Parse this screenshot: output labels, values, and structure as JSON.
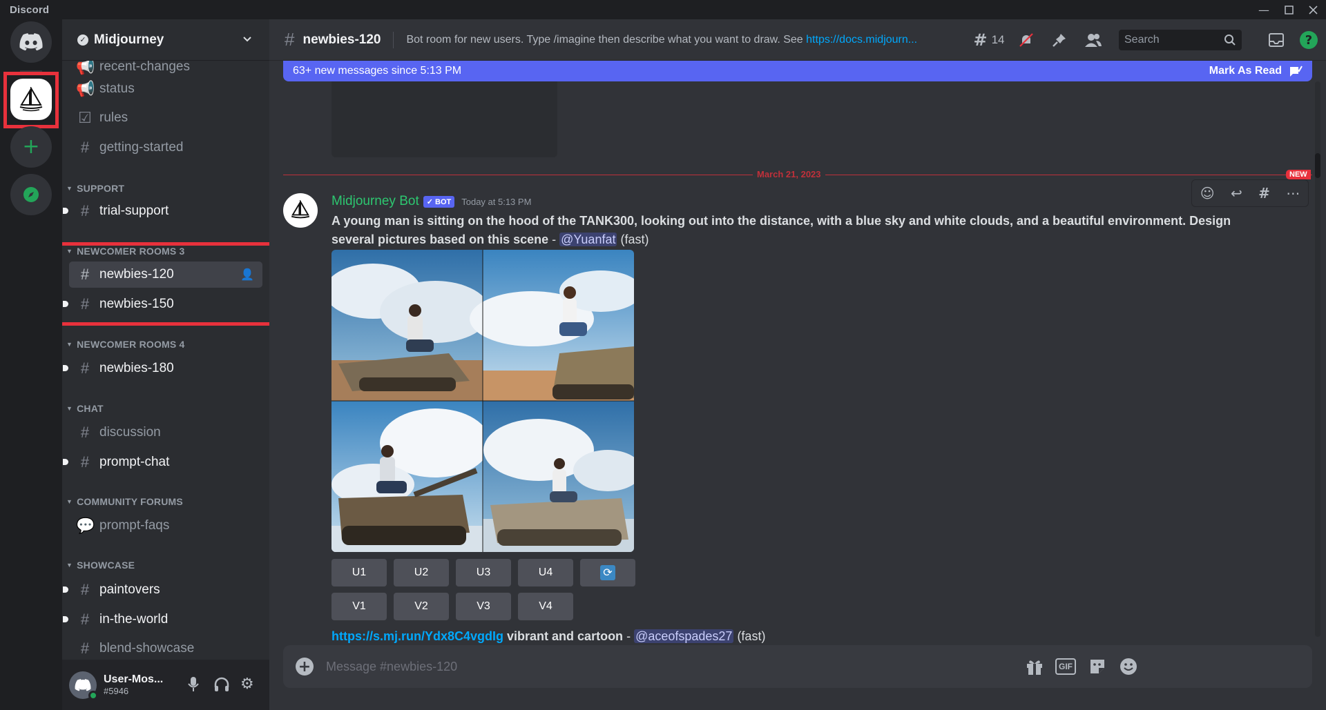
{
  "window": {
    "title": "Discord"
  },
  "servers": {
    "midjourney_tooltip": "Midjourney"
  },
  "guild": {
    "name": "Midjourney"
  },
  "channels": {
    "recent_changes": "recent-changes",
    "status": "status",
    "rules": "rules",
    "getting_started": "getting-started",
    "cat_support": "SUPPORT",
    "trial_support": "trial-support",
    "cat_newcomer3": "NEWCOMER ROOMS 3",
    "newbies_120": "newbies-120",
    "newbies_150": "newbies-150",
    "cat_newcomer4": "NEWCOMER ROOMS 4",
    "newbies_180": "newbies-180",
    "cat_chat": "CHAT",
    "discussion": "discussion",
    "prompt_chat": "prompt-chat",
    "cat_forums": "COMMUNITY FORUMS",
    "prompt_faqs": "prompt-faqs",
    "cat_showcase": "SHOWCASE",
    "paintovers": "paintovers",
    "in_the_world": "in-the-world",
    "blend_showcase": "blend-showcase"
  },
  "user": {
    "name": "User-Mos...",
    "tag": "#5946"
  },
  "header": {
    "channel": "newbies-120",
    "topic": "Bot room for new users. Type /imagine then describe what you want to draw. See ",
    "topic_link": "https://docs.midjourn...",
    "threads_count": "14",
    "search_placeholder": "Search"
  },
  "banner": {
    "text": "63+ new messages since 5:13 PM",
    "action": "Mark As Read"
  },
  "divider": {
    "date": "March 21, 2023",
    "new_badge": "NEW"
  },
  "message": {
    "author": "Midjourney Bot",
    "bot_badge": "✓ BOT",
    "time": "Today at 5:13 PM",
    "prompt_line1": "A young man is sitting on the hood of the TANK300, looking out into the distance, with a blue sky and white clouds, and a beautiful environment. Design",
    "prompt_line2": "several pictures based on this scene",
    "dash": " - ",
    "mention": "@Yuanfat",
    "mode": " (fast)",
    "buttons_row1": [
      "U1",
      "U2",
      "U3",
      "U4"
    ],
    "buttons_row2": [
      "V1",
      "V2",
      "V3",
      "V4"
    ]
  },
  "next_message": {
    "link": "https://s.mj.run/Ydx8C4vgdIg",
    "text": " vibrant and cartoon",
    "dash": " - ",
    "mention": "@aceofspades27",
    "mode": " (fast)"
  },
  "composer": {
    "placeholder": "Message #newbies-120",
    "gif_label": "GIF"
  },
  "colors": {
    "accent": "#5865f2",
    "online_green": "#23a559",
    "highlight_red": "#e8313c",
    "bot_name": "#2dc770",
    "link": "#00a8fc"
  }
}
